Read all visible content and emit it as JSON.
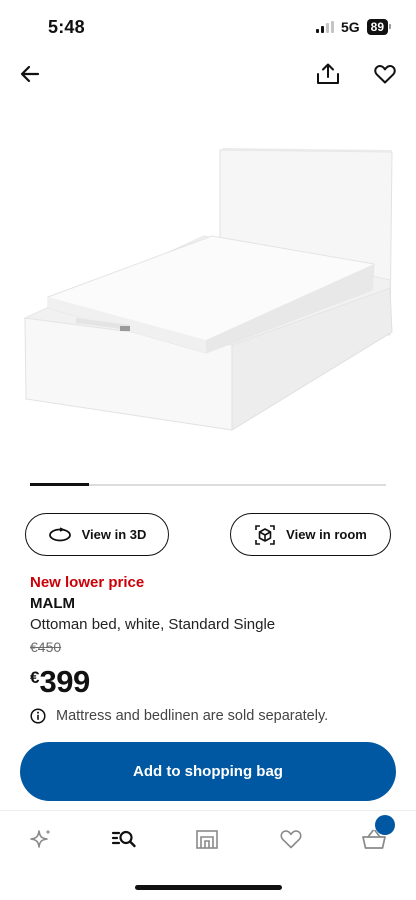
{
  "status_bar": {
    "time": "5:48",
    "network": "5G",
    "battery": "89"
  },
  "top_nav": {
    "back_icon": "back-arrow-icon",
    "share_icon": "share-icon",
    "favorite_icon": "heart-icon"
  },
  "product_image": {
    "subject": "white ottoman bed with mattress"
  },
  "carousel": {
    "current": 1,
    "total": 6
  },
  "view_buttons": {
    "view_3d_label": "View in 3D",
    "view_room_label": "View in room"
  },
  "product": {
    "price_tag": "New lower price",
    "name": "MALM",
    "description": "Ottoman bed, white, Standard Single",
    "old_price": "€450",
    "currency": "€",
    "price": "399",
    "notice": "Mattress and bedlinen are sold separately."
  },
  "cta": {
    "add_to_bag_label": "Add to shopping bag"
  },
  "tab_bar": {
    "items": [
      {
        "icon": "sparkle-icon"
      },
      {
        "icon": "search-list-icon"
      },
      {
        "icon": "store-icon"
      },
      {
        "icon": "heart-icon"
      },
      {
        "icon": "basket-icon"
      }
    ]
  },
  "colors": {
    "accent_blue": "#0058a3",
    "price_red": "#cc0008",
    "text": "#111111"
  }
}
